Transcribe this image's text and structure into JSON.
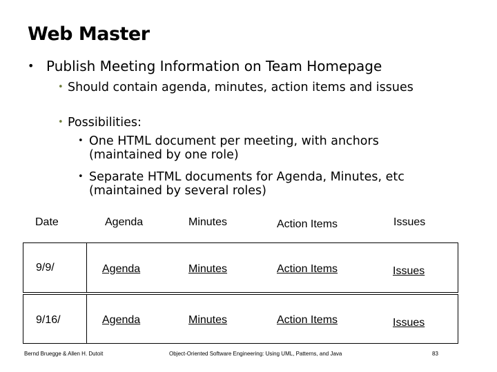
{
  "slide": {
    "title": "Web Master",
    "bullets": {
      "main": "Publish Meeting Information on Team Homepage",
      "sub1": "Should contain agenda, minutes, action items and issues",
      "sub2": "Possibilities:",
      "sub2_items": [
        "One HTML document per meeting, with anchors (maintained by one role)",
        "Separate HTML documents for Agenda, Minutes, etc (maintained by several roles)"
      ]
    },
    "bullet_glyph": "•",
    "colors": {
      "sub_bullet": "#6e7d3c"
    }
  },
  "table": {
    "headers": [
      "Date",
      "Agenda",
      "Minutes",
      "Action Items",
      "Issues"
    ],
    "rows": [
      {
        "date": "9/9/",
        "agenda": "Agenda",
        "minutes": "Minutes",
        "action_items": "Action Items",
        "issues": "Issues"
      },
      {
        "date": "9/16/",
        "agenda": "Agenda",
        "minutes": "Minutes",
        "action_items": "Action Items",
        "issues": "Issues"
      }
    ]
  },
  "footer": {
    "authors": "Bernd Bruegge & Allen H. Dutoit",
    "book": "Object-Oriented Software Engineering: Using UML, Patterns, and Java",
    "page": "83"
  }
}
